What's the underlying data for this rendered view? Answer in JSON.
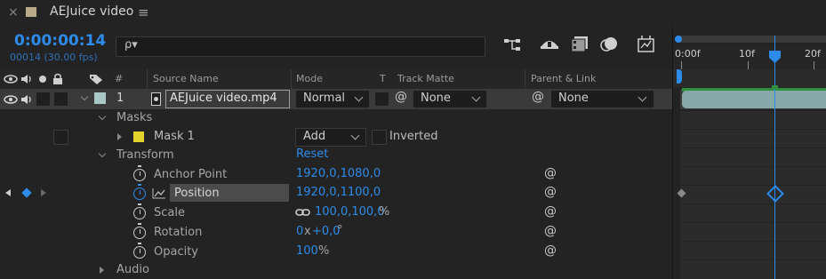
{
  "tab": {
    "title": "AEJuice video",
    "close_glyph": "×",
    "menu_glyph": "≡"
  },
  "header": {
    "timecode": "0:00:00:14",
    "frame_info": "00014 (30.00 fps)",
    "search_glyph": "ρ▾"
  },
  "columns": {
    "num": "#",
    "source_name": "Source Name",
    "mode": "Mode",
    "t": "T",
    "track_matte": "Track Matte",
    "parent_link": "Parent & Link"
  },
  "layer": {
    "index": "1",
    "name": "AEJuice video.mp4",
    "mode": "Normal",
    "track_matte": "None",
    "parent": "None",
    "label_color": "#a9c7c7"
  },
  "masks": {
    "label": "Masks",
    "mask1": {
      "name": "Mask 1",
      "mode": "Add",
      "inverted_label": "Inverted",
      "color": "#e3d32d"
    }
  },
  "transform": {
    "label": "Transform",
    "reset": "Reset",
    "anchor_point": {
      "name": "Anchor Point",
      "value": "1920,0,1080,0"
    },
    "position": {
      "name": "Position",
      "value": "1920,0,1100,0"
    },
    "scale": {
      "name": "Scale",
      "value": "100,0,100,0",
      "unit": "%"
    },
    "rotation": {
      "name": "Rotation",
      "turns": "0",
      "x": "x",
      "deg": "+0,0",
      "unit": "°"
    },
    "opacity": {
      "name": "Opacity",
      "value": "100",
      "unit": "%"
    }
  },
  "audio": {
    "label": "Audio"
  },
  "timeline": {
    "ruler": [
      "0:00f",
      "10f",
      "20f"
    ],
    "playhead_color": "#2d8ceb",
    "layer_bar_color": "#86a9a7"
  }
}
